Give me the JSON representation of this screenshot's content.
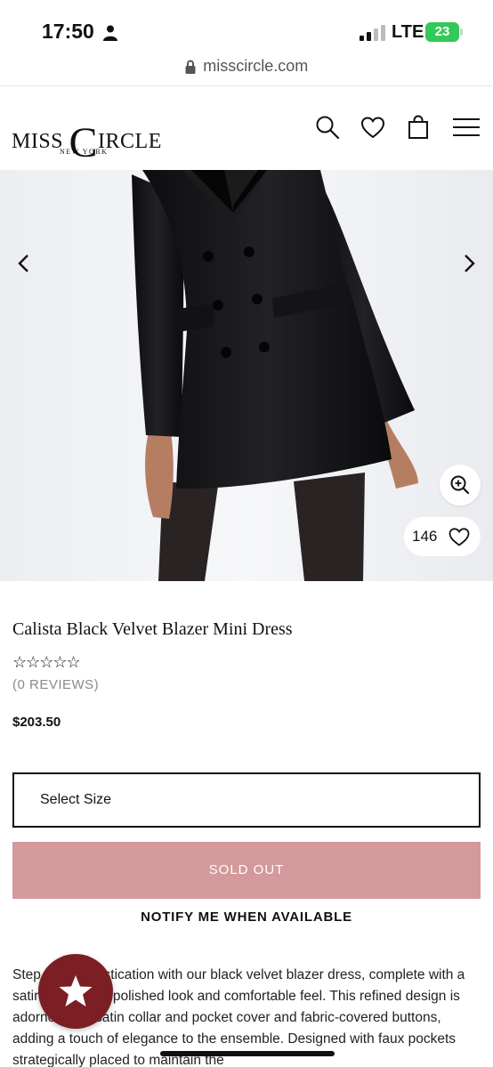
{
  "status_bar": {
    "time": "17:50",
    "network": "LTE",
    "battery": "23"
  },
  "browser": {
    "url": "misscircle.com"
  },
  "header": {
    "logo_main_left": "MISS ",
    "logo_c": "C",
    "logo_main_right": "IRCLE",
    "logo_sub": "NEW YORK"
  },
  "product": {
    "like_count": "146",
    "title": "Calista Black Velvet Blazer Mini Dress",
    "stars": "☆☆☆☆☆",
    "reviews": "(0 REVIEWS)",
    "price": "$203.50",
    "select_size_label": "Select Size",
    "sold_out_label": "SOLD OUT",
    "notify_label": "NOTIFY ME WHEN AVAILABLE",
    "description": "Step into sophistication with our black velvet blazer dress, complete with a satin lining for a polished look and comfortable feel. This refined design is adorned with satin collar and pocket cover and fabric-covered buttons, adding a touch of elegance to the ensemble. Designed with faux pockets strategically placed to maintain the"
  },
  "colors": {
    "sold_out_bg": "#d4999a",
    "fab_bg": "#7c1f24",
    "battery_green": "#34c759"
  },
  "icons": [
    "person-icon",
    "signal-icon",
    "lock-icon",
    "search-icon",
    "heart-icon",
    "bag-icon",
    "menu-icon",
    "chevron-left-icon",
    "chevron-right-icon",
    "zoom-in-icon",
    "star-icon"
  ]
}
